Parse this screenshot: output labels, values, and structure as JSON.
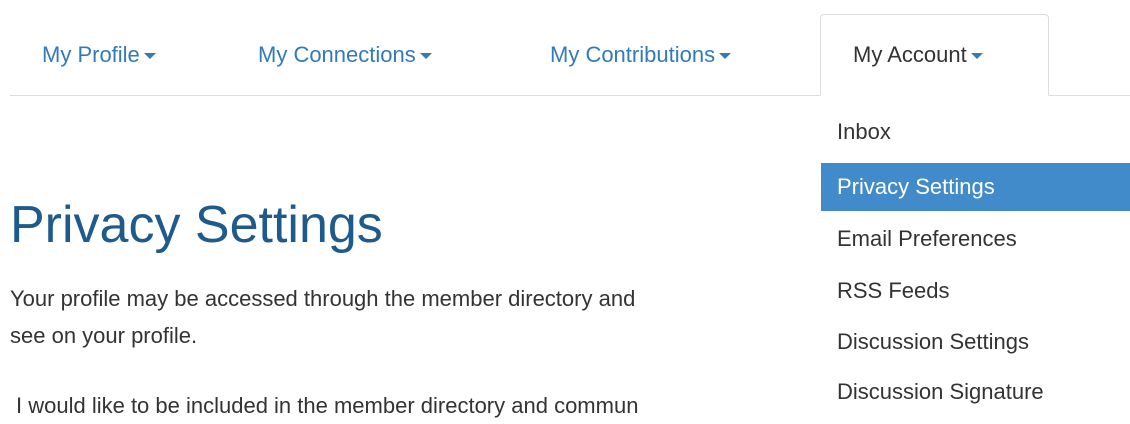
{
  "nav": {
    "tabs": [
      {
        "label": "My Profile"
      },
      {
        "label": "My Connections"
      },
      {
        "label": "My Contributions"
      },
      {
        "label": "My Account"
      }
    ]
  },
  "dropdown": {
    "items": [
      {
        "label": "Inbox"
      },
      {
        "label": "Privacy Settings",
        "active": true
      },
      {
        "label": "Email Preferences"
      },
      {
        "label": "RSS Feeds"
      },
      {
        "label": "Discussion Settings"
      },
      {
        "label": "Discussion Signature"
      }
    ]
  },
  "main": {
    "title": "Privacy Settings",
    "intro_line1": "Your profile may be accessed through the member directory and",
    "intro_line2": "see on your profile.",
    "directory_option": "I would like to be included in the member directory and commun"
  },
  "colors": {
    "link": "#337ab7",
    "heading": "#1f5a8c",
    "active_bg": "#428bca",
    "border": "#dddddd",
    "text": "#333333"
  }
}
